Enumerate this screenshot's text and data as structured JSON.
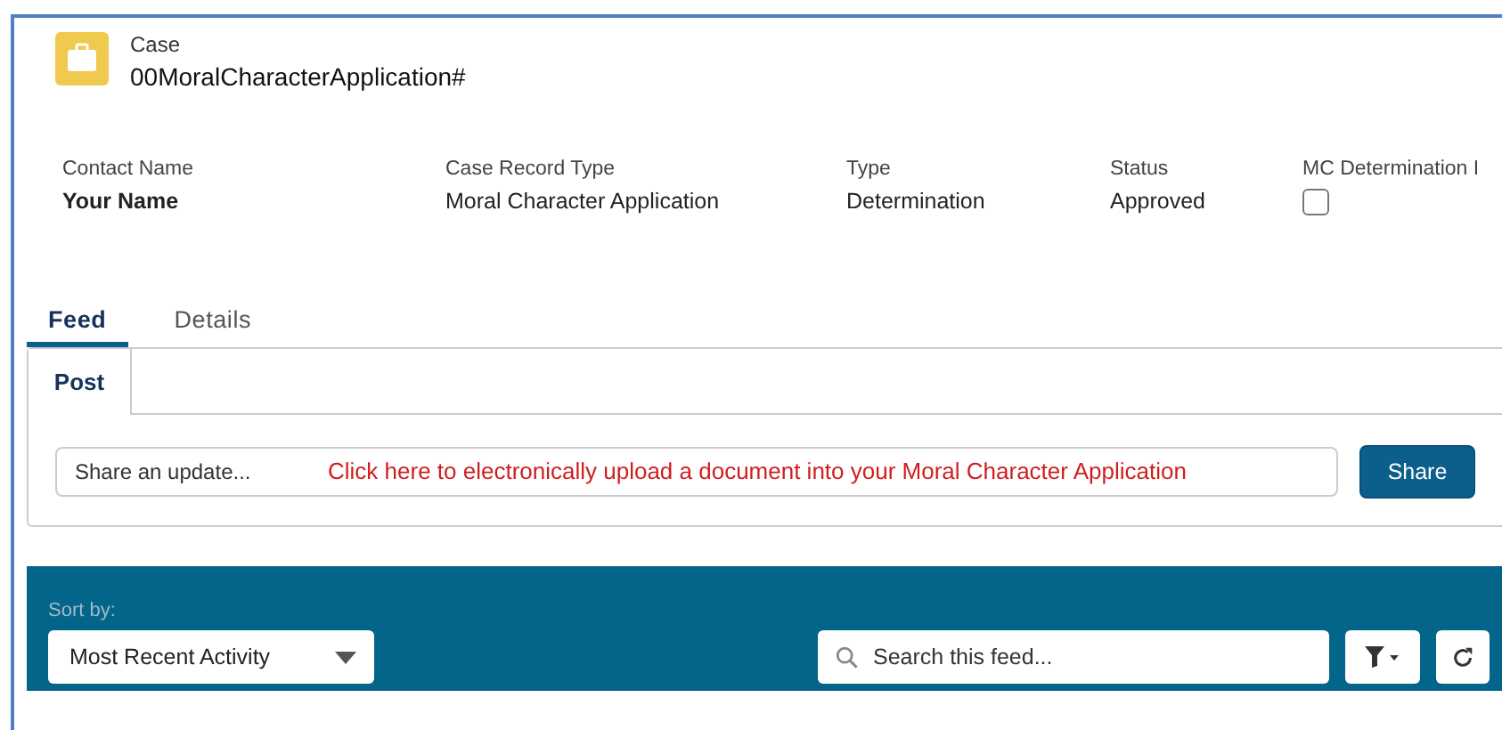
{
  "record": {
    "object": "Case",
    "name": "00MoralCharacterApplication#"
  },
  "highlights": [
    {
      "kind": "text",
      "label": "Contact Name",
      "value": "Your Name",
      "bold": true
    },
    {
      "kind": "text",
      "label": "Case Record Type",
      "value": "Moral Character Application",
      "bold": false
    },
    {
      "kind": "text",
      "label": "Type",
      "value": "Determination",
      "bold": false
    },
    {
      "kind": "text",
      "label": "Status",
      "value": "Approved",
      "bold": false
    },
    {
      "kind": "checkbox",
      "label": "MC Determination I",
      "checked": false
    }
  ],
  "tabs": [
    {
      "label": "Feed",
      "selected": true
    },
    {
      "label": "Details",
      "selected": false
    }
  ],
  "publisher": {
    "tabs": [
      {
        "label": "Post",
        "selected": true
      }
    ],
    "placeholder": "Share an update...",
    "annotation": "Click here to electronically upload a document into your Moral Character Application",
    "button": "Share"
  },
  "feed_bar": {
    "sort_label": "Sort by:",
    "sort_value": "Most Recent Activity",
    "search_placeholder": "Search this feed..."
  }
}
